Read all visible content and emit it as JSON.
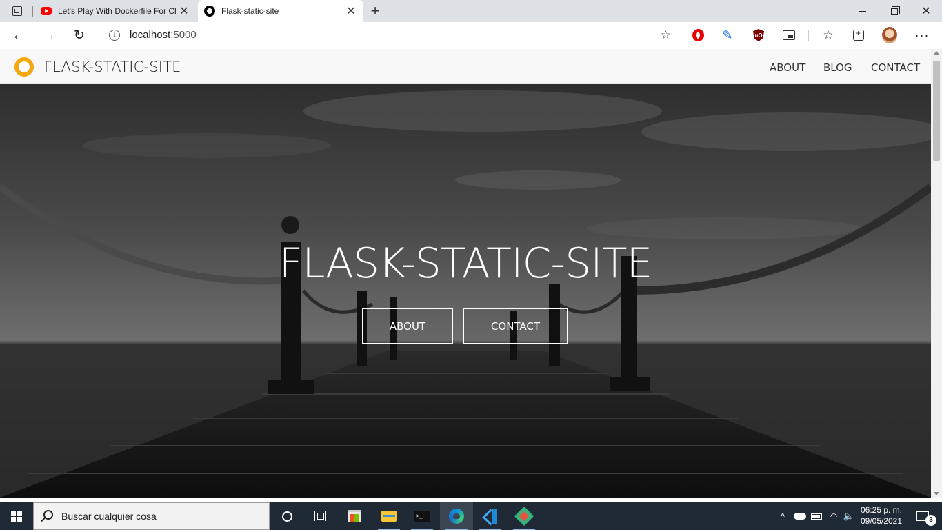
{
  "browser": {
    "tabs": [
      {
        "title": "Let's Play With Dockerfile For Clo",
        "favicon": "youtube-icon",
        "active": false
      },
      {
        "title": "Flask-static-site",
        "favicon": "site-icon",
        "active": true
      }
    ],
    "address": {
      "host": "localhost",
      "port": ":5000"
    },
    "close_glyph": "✕",
    "new_tab_glyph": "+",
    "back_glyph": "←",
    "forward_glyph": "→",
    "reload_glyph": "↻",
    "info_glyph": "i",
    "favorite_glyph": "☆",
    "menu_glyph": "···"
  },
  "site": {
    "brand": "FLASK-STATIC-SITE",
    "nav": [
      {
        "label": "ABOUT"
      },
      {
        "label": "BLOG"
      },
      {
        "label": "CONTACT"
      }
    ],
    "hero": {
      "title": "FLASK-STATIC-SITE",
      "buttons": [
        {
          "label": "ABOUT"
        },
        {
          "label": "CONTACT"
        }
      ]
    },
    "colors": {
      "logo": "#f5a70f",
      "navbar_bg": "#f8f8f8"
    }
  },
  "taskbar": {
    "search_placeholder": "Buscar cualquier cosa",
    "clock_time": "06:25 p. m.",
    "clock_date": "09/05/2021",
    "notification_count": "3",
    "tray_chevron": "^",
    "apps": [
      "cortana-icon",
      "task-view-icon",
      "store-icon",
      "file-explorer-icon",
      "terminal-icon",
      "edge-icon",
      "vscode-icon",
      "gitkraken-icon"
    ]
  }
}
